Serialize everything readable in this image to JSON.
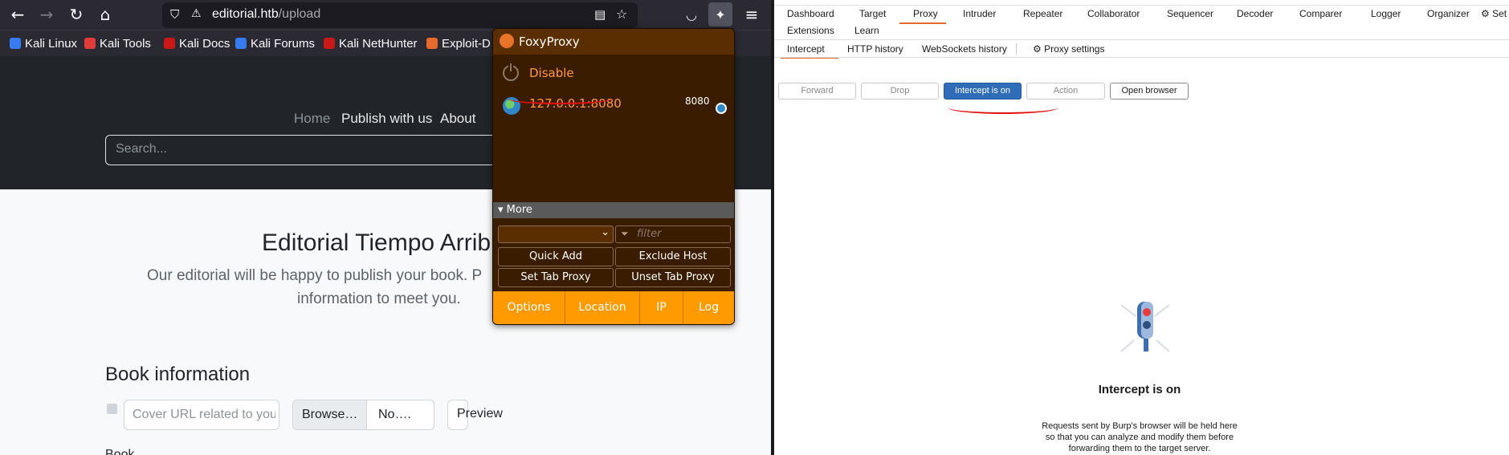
{
  "browser": {
    "url_host": "editorial.htb",
    "url_path": "/upload",
    "bookmarks": [
      {
        "label": "Kali Linux",
        "color": "#367bf0"
      },
      {
        "label": "Kali Tools",
        "color": "#e23b3b"
      },
      {
        "label": "Kali Docs",
        "color": "#c81818"
      },
      {
        "label": "Kali Forums",
        "color": "#367bf0"
      },
      {
        "label": "Kali NetHunter",
        "color": "#c81818"
      },
      {
        "label": "Exploit-D",
        "color": "#e8692c"
      }
    ]
  },
  "site": {
    "nav": {
      "home": "Home",
      "publish": "Publish with us",
      "about": "About"
    },
    "search_placeholder": "Search...",
    "title": "Editorial Tiempo Arrib",
    "subtitle_line1": "Our editorial will be happy to publish your book. P",
    "subtitle_line2": "information to meet you.",
    "book_info_heading": "Book information",
    "cover_url_placeholder": "Cover URL related to your",
    "browse_label": "Browse…",
    "file_label": "No….",
    "preview_label": "Preview",
    "book_label": "Book"
  },
  "foxyproxy": {
    "title": "FoxyProxy",
    "disable_label": "Disable",
    "proxy_label": "127.0.0.1:8080",
    "proxy_port": "8080",
    "more_label": "▾ More",
    "filter_placeholder": "filter",
    "buttons": {
      "quick_add": "Quick Add",
      "exclude_host": "Exclude Host",
      "set_tab_proxy": "Set Tab Proxy",
      "unset_tab_proxy": "Unset Tab Proxy"
    },
    "bottom_tabs": {
      "options": "Options",
      "location": "Location",
      "ip": "IP",
      "log": "Log"
    },
    "accent_color": "#ff9a00"
  },
  "burp": {
    "main_tabs": {
      "dashboard": "Dashboard",
      "target": "Target",
      "proxy": "Proxy",
      "intruder": "Intruder",
      "repeater": "Repeater",
      "collaborator": "Collaborator",
      "sequencer": "Sequencer",
      "decoder": "Decoder",
      "comparer": "Comparer",
      "logger": "Logger",
      "organizer": "Organizer",
      "settings": "Set",
      "extensions": "Extensions",
      "learn": "Learn"
    },
    "proxy_tabs": {
      "intercept": "Intercept",
      "http_history": "HTTP history",
      "websockets_history": "WebSockets history",
      "proxy_settings": "Proxy settings"
    },
    "buttons": {
      "forward": "Forward",
      "drop": "Drop",
      "intercept": "Intercept is on",
      "action": "Action",
      "open_browser": "Open browser"
    },
    "empty_title": "Intercept is on",
    "empty_desc": "Requests sent by Burp's browser will be held here so that you can analyze and modify them before forwarding them to the target server.",
    "accent_color": "#e8692c"
  }
}
